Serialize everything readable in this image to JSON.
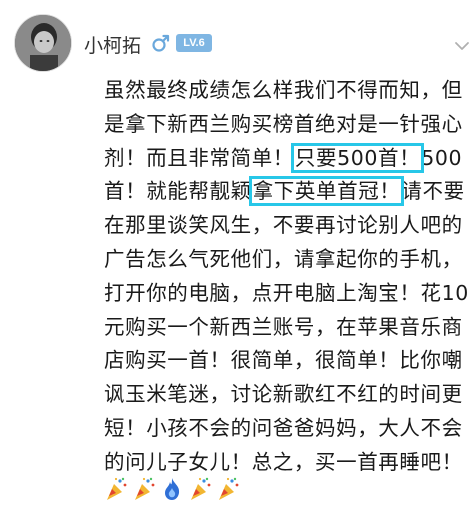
{
  "user": {
    "name": "小柯拓",
    "level": "LV.6"
  },
  "post": {
    "lines": [
      [
        "虽然最终成绩怎么样我们不得而知，但"
      ],
      [
        "是拿下新西兰购买榜首绝对是一针强心"
      ],
      [
        "剂！而且非常简单！",
        "只要500首！",
        "500"
      ],
      [
        "首！就能帮靓颖",
        "拿下英单首冠！",
        "请不要"
      ],
      [
        "在那里谈笑风生，不要再讨论别人吧的"
      ],
      [
        "广告怎么气死他们，请拿起你的手机，"
      ],
      [
        "打开你的电脑，点开电脑上淘宝！花10"
      ],
      [
        "元购买一个新西兰账号，在苹果音乐商"
      ],
      [
        "店购买一首！很简单，很简单！比你嘲"
      ],
      [
        "讽玉米笔迷，讨论新歌红不红的时间更"
      ],
      [
        "短！小孩不会的问爸爸妈妈，大人不会"
      ],
      [
        "的问儿子女儿！总之，买一首再睡吧！"
      ]
    ],
    "emojis": [
      "party-popper-icon",
      "party-popper-icon",
      "flame-icon",
      "party-popper-icon",
      "party-popper-icon"
    ]
  },
  "colors": {
    "highlight": "#27c7e8",
    "level_badge": "#7fb6e3",
    "gender_icon": "#6aa8dc"
  }
}
